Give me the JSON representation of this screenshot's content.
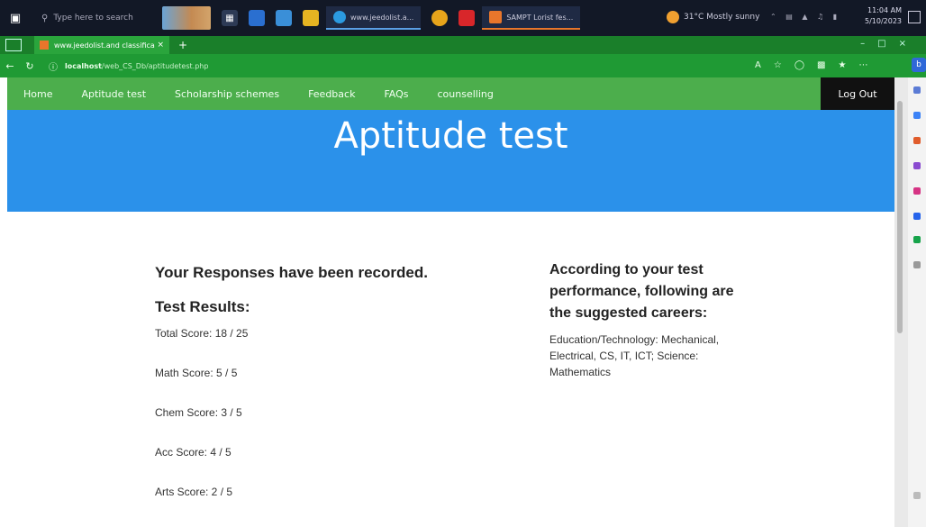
{
  "taskbar": {
    "search_placeholder": "Type here to search",
    "apps": [
      {
        "label": "www.jeedolist.a..."
      },
      {
        "label": "SAMPT Lorist fes..."
      }
    ],
    "weather": "31°C Mostly sunny",
    "clock_time": "11:04 AM",
    "clock_date": "5/10/2023"
  },
  "browser": {
    "tab_title": "www.jeedolist.and classificat...",
    "url_host": "localhost",
    "url_path": "/web_CS_Db/aptitudetest.php"
  },
  "nav": {
    "items": [
      "Home",
      "Aptitude test",
      "Scholarship schemes",
      "Feedback",
      "FAQs",
      "counselling"
    ],
    "logout": "Log Out"
  },
  "banner": {
    "title": "Aptitude test"
  },
  "results": {
    "recorded": "Your Responses have been recorded.",
    "heading": "Test Results:",
    "scores": [
      "Total Score: 18 / 25",
      "Math Score: 5 / 5",
      "Chem Score: 3 / 5",
      "Acc Score: 4 / 5",
      "Arts Score: 2 / 5"
    ]
  },
  "careers": {
    "heading": "According to your test performance, following are the suggested careers:",
    "list": "Education/Technology: Mechanical, Electrical, CS, IT, ICT; Science: Mathematics"
  }
}
